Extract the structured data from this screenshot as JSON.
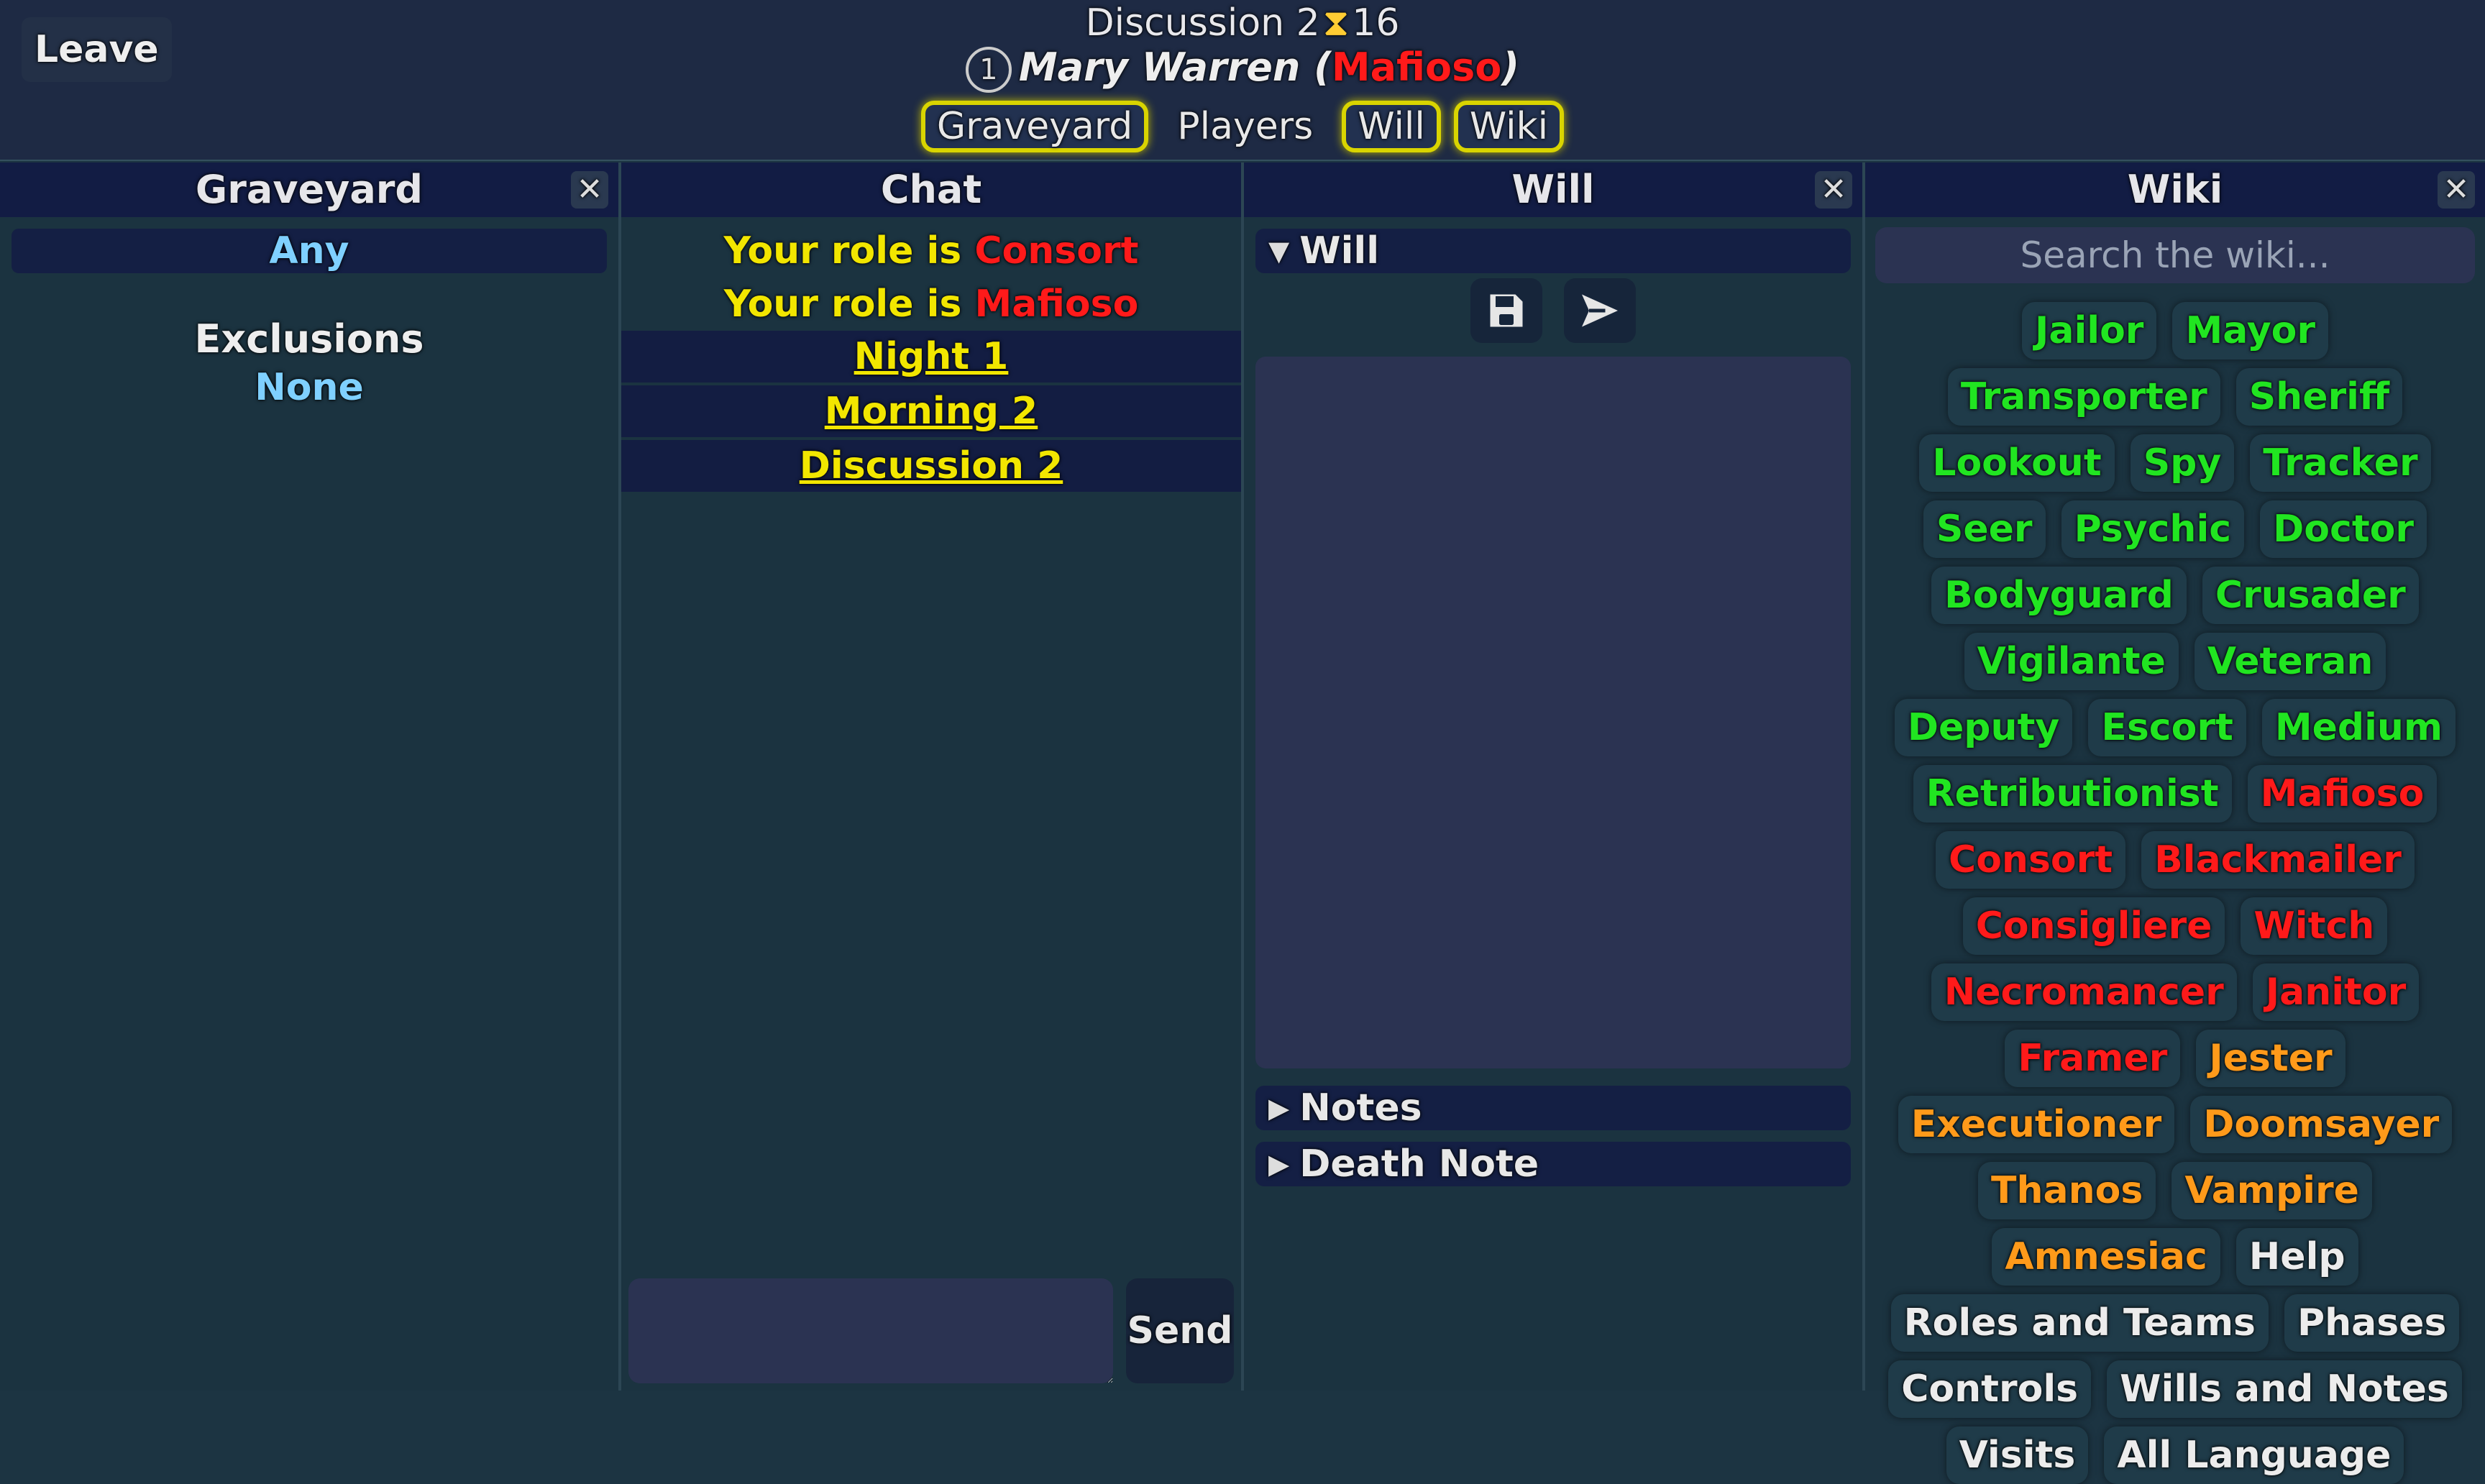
{
  "header": {
    "leave_label": "Leave",
    "phase": "Discussion 2",
    "timer_icon": "hourglass-icon",
    "timer": "16",
    "player_number": "1",
    "player_name": "Mary Warren",
    "player_role": "Mafioso",
    "tabs": [
      {
        "label": "Graveyard",
        "active": true
      },
      {
        "label": "Players",
        "active": false
      },
      {
        "label": "Will",
        "active": true
      },
      {
        "label": "Wiki",
        "active": true
      }
    ]
  },
  "graveyard": {
    "title": "Graveyard",
    "close_label": "✕",
    "any_label": "Any",
    "exclusions_label": "Exclusions",
    "exclusions_value": "None"
  },
  "chat": {
    "title": "Chat",
    "messages": [
      {
        "prefix": "Your role is ",
        "role": "Consort"
      },
      {
        "prefix": "Your role is ",
        "role": "Mafioso"
      }
    ],
    "phases": [
      "Night 1",
      "Morning 2",
      "Discussion 2"
    ],
    "input_value": "",
    "send_label": "Send"
  },
  "will": {
    "title": "Will",
    "close_label": "✕",
    "will_section": "Will",
    "notes_section": "Notes",
    "death_note_section": "Death Note",
    "will_text": ""
  },
  "wiki": {
    "title": "Wiki",
    "close_label": "✕",
    "search_placeholder": "Search the wiki...",
    "colors": {
      "town": "#21e521",
      "mafia": "#ff1a1a",
      "neutral": "#ff9a1a",
      "help": "#ececec"
    },
    "items": [
      {
        "label": "Jailor",
        "group": "town"
      },
      {
        "label": "Mayor",
        "group": "town"
      },
      {
        "label": "Transporter",
        "group": "town"
      },
      {
        "label": "Sheriff",
        "group": "town"
      },
      {
        "label": "Lookout",
        "group": "town"
      },
      {
        "label": "Spy",
        "group": "town"
      },
      {
        "label": "Tracker",
        "group": "town"
      },
      {
        "label": "Seer",
        "group": "town"
      },
      {
        "label": "Psychic",
        "group": "town"
      },
      {
        "label": "Doctor",
        "group": "town"
      },
      {
        "label": "Bodyguard",
        "group": "town"
      },
      {
        "label": "Crusader",
        "group": "town"
      },
      {
        "label": "Vigilante",
        "group": "town"
      },
      {
        "label": "Veteran",
        "group": "town"
      },
      {
        "label": "Deputy",
        "group": "town"
      },
      {
        "label": "Escort",
        "group": "town"
      },
      {
        "label": "Medium",
        "group": "town"
      },
      {
        "label": "Retributionist",
        "group": "town"
      },
      {
        "label": "Mafioso",
        "group": "mafia"
      },
      {
        "label": "Consort",
        "group": "mafia"
      },
      {
        "label": "Blackmailer",
        "group": "mafia"
      },
      {
        "label": "Consigliere",
        "group": "mafia"
      },
      {
        "label": "Witch",
        "group": "mafia"
      },
      {
        "label": "Necromancer",
        "group": "mafia"
      },
      {
        "label": "Janitor",
        "group": "mafia"
      },
      {
        "label": "Framer",
        "group": "mafia"
      },
      {
        "label": "Jester",
        "group": "neutral"
      },
      {
        "label": "Executioner",
        "group": "neutral"
      },
      {
        "label": "Doomsayer",
        "group": "neutral"
      },
      {
        "label": "Thanos",
        "group": "neutral"
      },
      {
        "label": "Vampire",
        "group": "neutral"
      },
      {
        "label": "Amnesiac",
        "group": "neutral"
      },
      {
        "label": "Help",
        "group": "help"
      },
      {
        "label": "Roles and Teams",
        "group": "help"
      },
      {
        "label": "Phases",
        "group": "help"
      },
      {
        "label": "Controls",
        "group": "help"
      },
      {
        "label": "Wills and Notes",
        "group": "help"
      },
      {
        "label": "Visits",
        "group": "help"
      },
      {
        "label": "All Language",
        "group": "help"
      }
    ]
  }
}
